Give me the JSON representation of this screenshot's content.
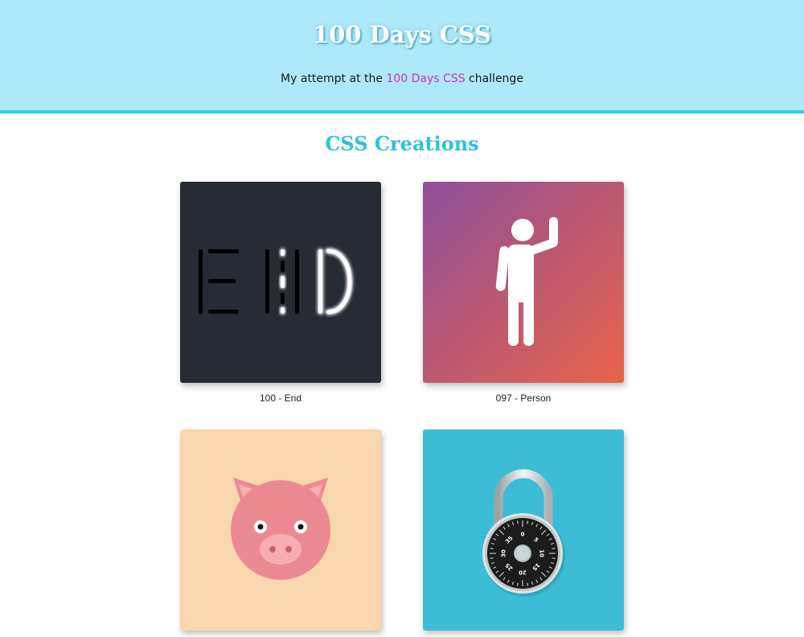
{
  "header": {
    "title": "100 Days CSS",
    "tagline_before": "My attempt at the ",
    "tagline_link": "100 Days CSS",
    "tagline_after": " challenge"
  },
  "section": {
    "title": "CSS Creations"
  },
  "cards": [
    {
      "caption": "100 - End",
      "bg": "#272b33"
    },
    {
      "caption": "097 - Person",
      "bg_from": "#8e4f99",
      "bg_to": "#e8634a"
    },
    {
      "caption": "",
      "bg": "#f8d6ae"
    },
    {
      "caption": "",
      "bg": "#3dbdd5"
    }
  ],
  "lock_dial_numbers": [
    "0",
    "5",
    "10",
    "15",
    "20",
    "25",
    "30",
    "35"
  ],
  "colors": {
    "header_bg": "#aee9fb",
    "header_border": "#33cbe8",
    "link": "#c934b6",
    "section_title": "#2dc0df"
  }
}
